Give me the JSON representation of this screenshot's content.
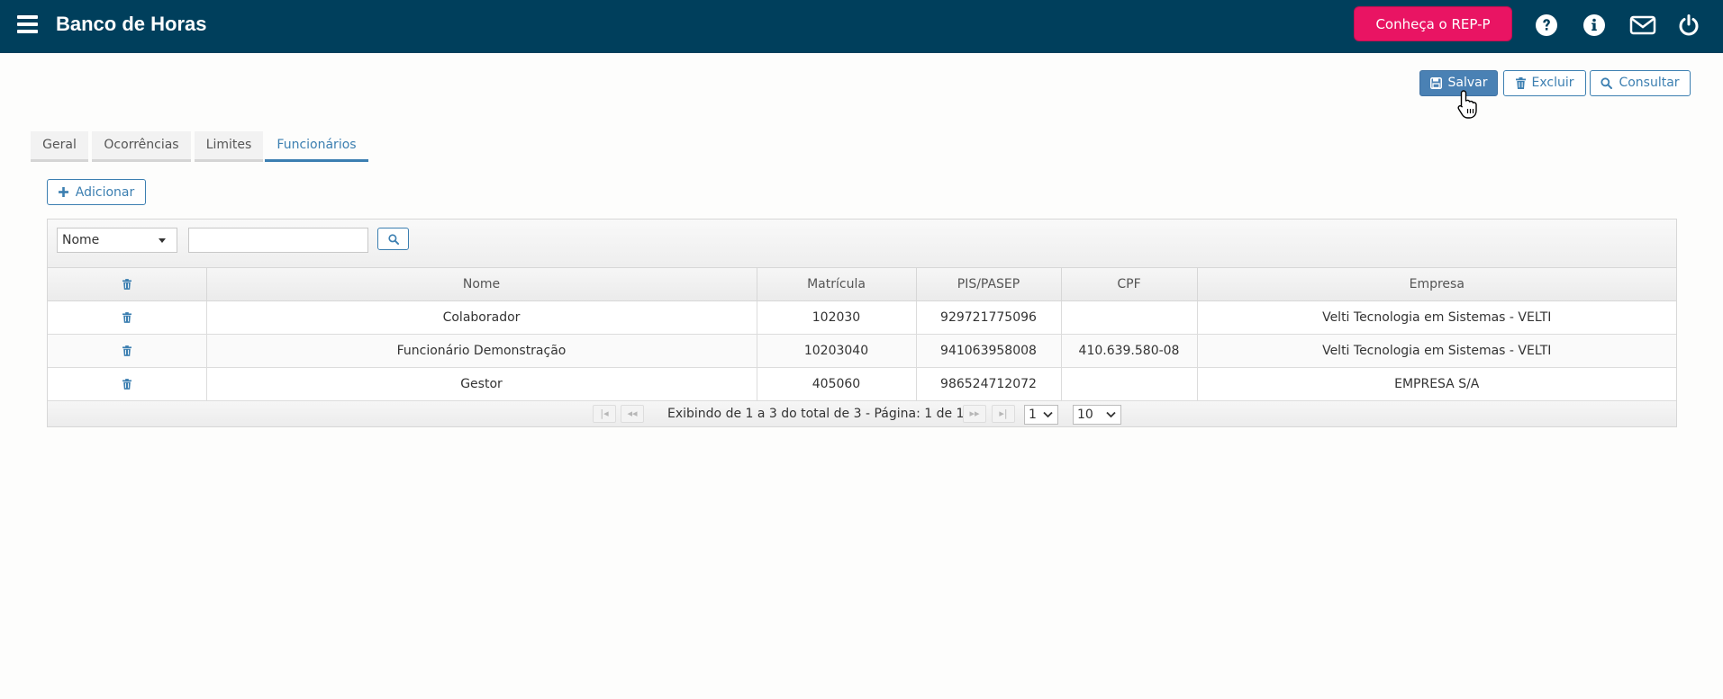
{
  "header": {
    "title": "Banco de Horas",
    "rep_button": "Conheça o REP-P",
    "icons": [
      "menu-icon",
      "help-icon",
      "info-icon",
      "mail-icon",
      "power-icon"
    ]
  },
  "actions": {
    "save": "Salvar",
    "delete": "Excluir",
    "query": "Consultar"
  },
  "tabs": [
    {
      "label": "Geral",
      "active": false
    },
    {
      "label": "Ocorrências",
      "active": false
    },
    {
      "label": "Limites",
      "active": false
    },
    {
      "label": "Funcionários",
      "active": true
    }
  ],
  "add_button": "Adicionar",
  "filter": {
    "field": "Nome",
    "value": ""
  },
  "table": {
    "columns": [
      "",
      "Nome",
      "Matrícula",
      "PIS/PASEP",
      "CPF",
      "Empresa"
    ],
    "rows": [
      {
        "nome": "Colaborador",
        "matricula": "102030",
        "pis": "929721775096",
        "cpf": "",
        "empresa": "Velti Tecnologia em Sistemas - VELTI"
      },
      {
        "nome": "Funcionário Demonstração",
        "matricula": "10203040",
        "pis": "941063958008",
        "cpf": "410.639.580-08",
        "empresa": "Velti Tecnologia em Sistemas - VELTI"
      },
      {
        "nome": "Gestor",
        "matricula": "405060",
        "pis": "986524712072",
        "cpf": "",
        "empresa": "EMPRESA S/A"
      }
    ]
  },
  "pager": {
    "summary": "Exibindo de 1 a 3 do total de 3 - Página: 1 de 1",
    "page": "1",
    "page_size": "10"
  },
  "colors": {
    "topbar": "#003f5c",
    "accent": "#3c7fb1",
    "rep_button": "#e91463"
  }
}
